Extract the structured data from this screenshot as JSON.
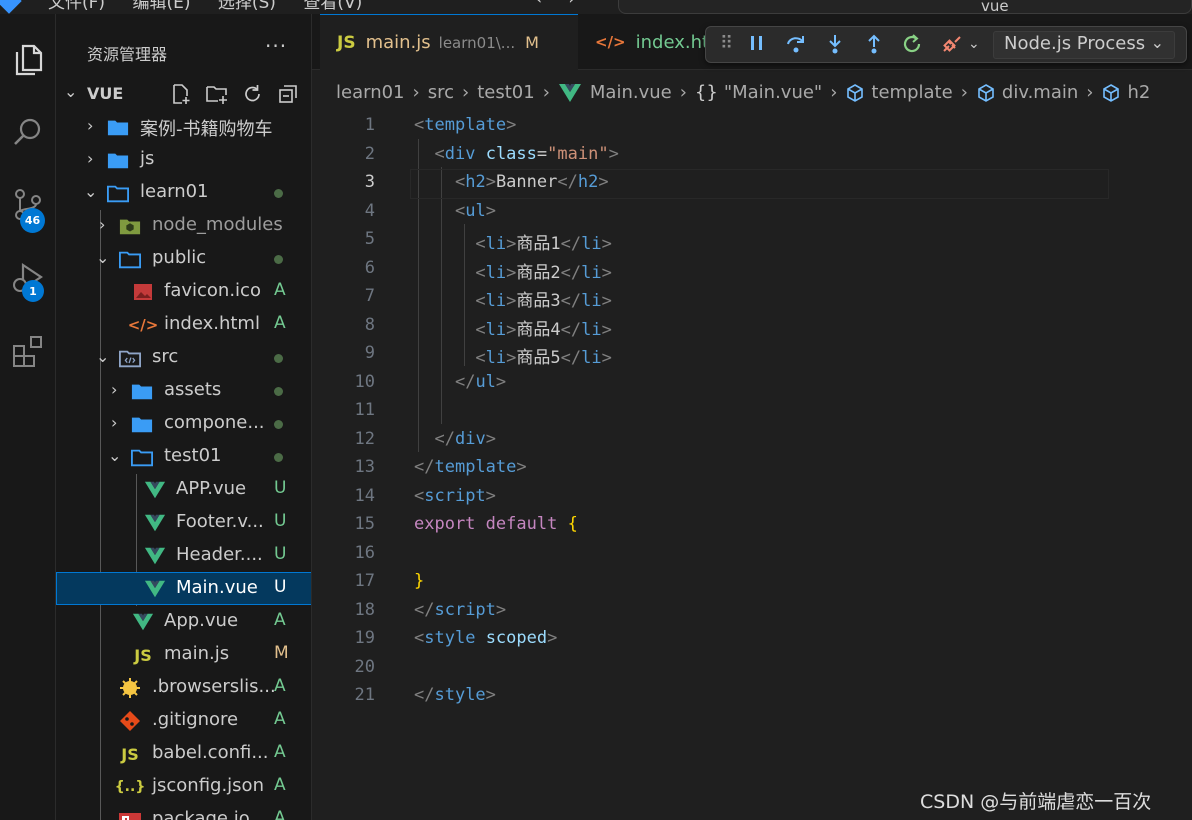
{
  "titlebar": {
    "menus": [
      "文件(F)",
      "编辑(E)",
      "选择(S)",
      "查看(V)"
    ],
    "search_value": "vue"
  },
  "activity": {
    "scm_badge": "46",
    "debug_badge": "1"
  },
  "sidebar": {
    "title": "资源管理器",
    "more": "···",
    "root": "VUE",
    "items": [
      {
        "label": "案例-书籍购物车",
        "type": "folder",
        "status": ""
      },
      {
        "label": "js",
        "type": "folder",
        "status": ""
      },
      {
        "label": "learn01",
        "type": "folder-open",
        "status": "dot"
      },
      {
        "label": "node_modules",
        "type": "node",
        "status": ""
      },
      {
        "label": "public",
        "type": "folder-open",
        "status": "dot"
      },
      {
        "label": "favicon.ico",
        "type": "image",
        "status": "A"
      },
      {
        "label": "index.html",
        "type": "html",
        "status": "A"
      },
      {
        "label": "src",
        "type": "src",
        "status": "dot"
      },
      {
        "label": "assets",
        "type": "folder",
        "status": "dot"
      },
      {
        "label": "compone...",
        "type": "folder",
        "status": "dot"
      },
      {
        "label": "test01",
        "type": "folder-open",
        "status": "dot"
      },
      {
        "label": "APP.vue",
        "type": "vue",
        "status": "U"
      },
      {
        "label": "Footer.v...",
        "type": "vue",
        "status": "U"
      },
      {
        "label": "Header....",
        "type": "vue",
        "status": "U"
      },
      {
        "label": "Main.vue",
        "type": "vue",
        "status": "U"
      },
      {
        "label": "App.vue",
        "type": "vue",
        "status": "A"
      },
      {
        "label": "main.js",
        "type": "js",
        "status": "M"
      },
      {
        "label": ".browserslis...",
        "type": "browsers",
        "status": "A"
      },
      {
        "label": ".gitignore",
        "type": "git",
        "status": "A"
      },
      {
        "label": "babel.confi...",
        "type": "js",
        "status": "A"
      },
      {
        "label": "jsconfig.json",
        "type": "json",
        "status": "A"
      },
      {
        "label": "package.jo...",
        "type": "npm",
        "status": "A"
      }
    ]
  },
  "tabs": [
    {
      "icon": "JS",
      "name": "main.js",
      "path": "learn01\\...",
      "mark": "M"
    },
    {
      "icon": "</>",
      "name": "index.html",
      "path": "",
      "mark": ""
    }
  ],
  "debug": {
    "process": "Node.js Process"
  },
  "breadcrumb": {
    "items": [
      "learn01",
      "src",
      "test01",
      "Main.vue",
      "\"Main.vue\"",
      "template",
      "div.main",
      "h2"
    ],
    "obj_prefix": "{}"
  },
  "editor": {
    "current_line": 3,
    "line_numbers": [
      "1",
      "2",
      "3",
      "4",
      "5",
      "6",
      "7",
      "8",
      "9",
      "10",
      "11",
      "12",
      "13",
      "14",
      "15",
      "16",
      "17",
      "18",
      "19",
      "20",
      "21"
    ],
    "text": {
      "banner": "Banner",
      "items": [
        "商品1",
        "商品2",
        "商品3",
        "商品4",
        "商品5"
      ]
    }
  },
  "watermark": "CSDN @与前端虐恋一百次",
  "colors": {
    "accent": "#0078d4",
    "added": "#73c991",
    "modified": "#e2c08d",
    "tag": "#569cd6",
    "attr": "#9cdcfe",
    "string": "#ce9178",
    "keyword": "#c586c0"
  }
}
